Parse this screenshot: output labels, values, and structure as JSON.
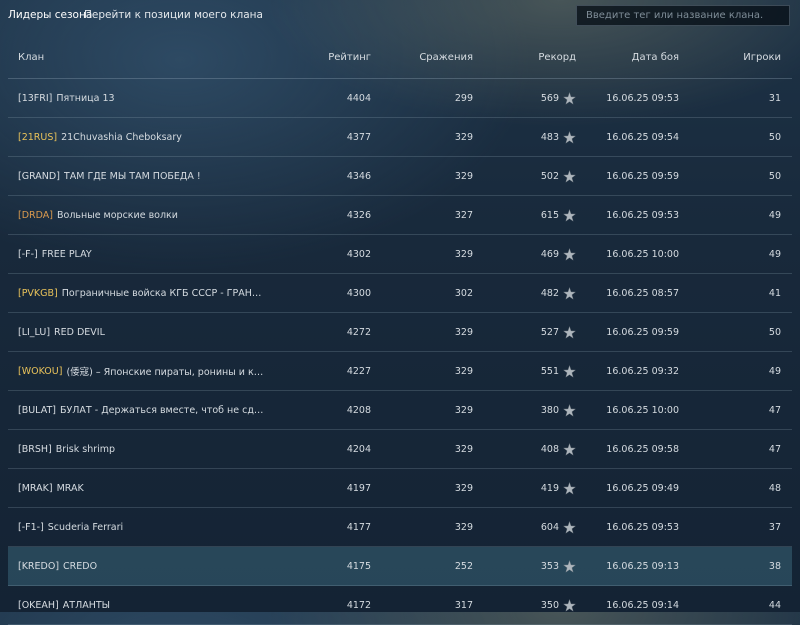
{
  "tabs": {
    "leaders": "Лидеры сезона",
    "my_clan": "Перейти к позиции моего клана"
  },
  "search": {
    "placeholder": "Введите тег или название клана."
  },
  "columns": {
    "clan": "Клан",
    "rating": "Рейтинг",
    "battles": "Сражения",
    "record": "Рекорд",
    "date": "Дата боя",
    "players": "Игроки"
  },
  "colors": {
    "tag_gold": "#e8c25a",
    "tag_orange": "#d99a4e",
    "highlight_row": "#3f7f93"
  },
  "rows": [
    {
      "tag": "[13FRI]",
      "tag_color": "white",
      "name": "Пятница 13",
      "rating": "4404",
      "battles": "299",
      "record": "569",
      "date": "16.06.25 09:53",
      "players": "31"
    },
    {
      "tag": "[21RUS]",
      "tag_color": "gold",
      "name": "21Chuvashia Cheboksary",
      "rating": "4377",
      "battles": "329",
      "record": "483",
      "date": "16.06.25 09:54",
      "players": "50"
    },
    {
      "tag": "[GRAND]",
      "tag_color": "white",
      "name": "ТАМ ГДЕ МЫ ТАМ ПОБЕДА !",
      "rating": "4346",
      "battles": "329",
      "record": "502",
      "date": "16.06.25 09:59",
      "players": "50"
    },
    {
      "tag": "[DRDA]",
      "tag_color": "orange",
      "name": "Вольные морские волки",
      "rating": "4326",
      "battles": "327",
      "record": "615",
      "date": "16.06.25 09:53",
      "players": "49"
    },
    {
      "tag": "[-F-]",
      "tag_color": "white",
      "name": "FREE PLAY",
      "rating": "4302",
      "battles": "329",
      "record": "469",
      "date": "16.06.25 10:00",
      "players": "49"
    },
    {
      "tag": "[PVKGB]",
      "tag_color": "gold",
      "name": "Пограничные войска КГБ СССР - ГРАНИЦА НА ЗА...",
      "rating": "4300",
      "battles": "302",
      "record": "482",
      "date": "16.06.25 08:57",
      "players": "41"
    },
    {
      "tag": "[LI_LU]",
      "tag_color": "white",
      "name": "RED DEVIL",
      "rating": "4272",
      "battles": "329",
      "record": "527",
      "date": "16.06.25 09:59",
      "players": "50"
    },
    {
      "tag": "[WOKOU]",
      "tag_color": "gold",
      "name": "(倭寇) – Японские пираты, ронины и контрабанд...",
      "rating": "4227",
      "battles": "329",
      "record": "551",
      "date": "16.06.25 09:32",
      "players": "49"
    },
    {
      "tag": "[BULAT]",
      "tag_color": "white",
      "name": "БУЛАТ - Держаться вместе, чтоб не сдуло.",
      "rating": "4208",
      "battles": "329",
      "record": "380",
      "date": "16.06.25 10:00",
      "players": "47"
    },
    {
      "tag": "[BRSH]",
      "tag_color": "white",
      "name": "Brisk shrimp",
      "rating": "4204",
      "battles": "329",
      "record": "408",
      "date": "16.06.25 09:58",
      "players": "47"
    },
    {
      "tag": "[MRAK]",
      "tag_color": "white",
      "name": "MRAK",
      "rating": "4197",
      "battles": "329",
      "record": "419",
      "date": "16.06.25 09:49",
      "players": "48"
    },
    {
      "tag": "[-F1-]",
      "tag_color": "white",
      "name": "Scuderia Ferrari",
      "rating": "4177",
      "battles": "329",
      "record": "604",
      "date": "16.06.25 09:53",
      "players": "37"
    },
    {
      "tag": "[KREDO]",
      "tag_color": "white",
      "name": "CREDO",
      "rating": "4175",
      "battles": "252",
      "record": "353",
      "date": "16.06.25 09:13",
      "players": "38",
      "highlight": true
    },
    {
      "tag": "[OKEAH]",
      "tag_color": "white",
      "name": "АТЛАНТЫ",
      "rating": "4172",
      "battles": "317",
      "record": "350",
      "date": "16.06.25 09:14",
      "players": "44"
    }
  ]
}
